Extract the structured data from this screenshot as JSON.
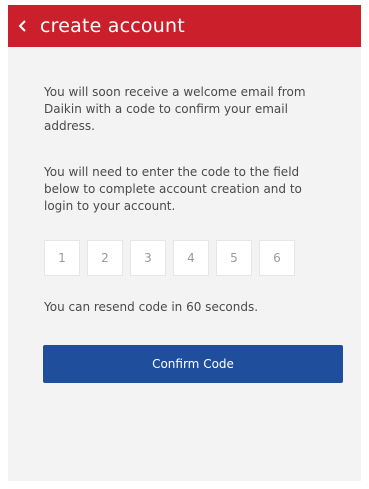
{
  "header": {
    "title": "create account",
    "back_icon": "chevron-left-icon"
  },
  "main": {
    "intro_text": "You will soon receive a welcome  email from Daikin with a code to confirm your email address.",
    "instruction_text": "You will need to enter the code to the field below to complete account creation and to login to your account.",
    "code_fields": [
      "1",
      "2",
      "3",
      "4",
      "5",
      "6"
    ],
    "resend_text": "You can resend code in 60 seconds.",
    "confirm_label": "Confirm Code"
  },
  "colors": {
    "header_bg": "#cc1f2c",
    "content_bg": "#f3f3f3",
    "button_bg": "#1f4f9c"
  }
}
